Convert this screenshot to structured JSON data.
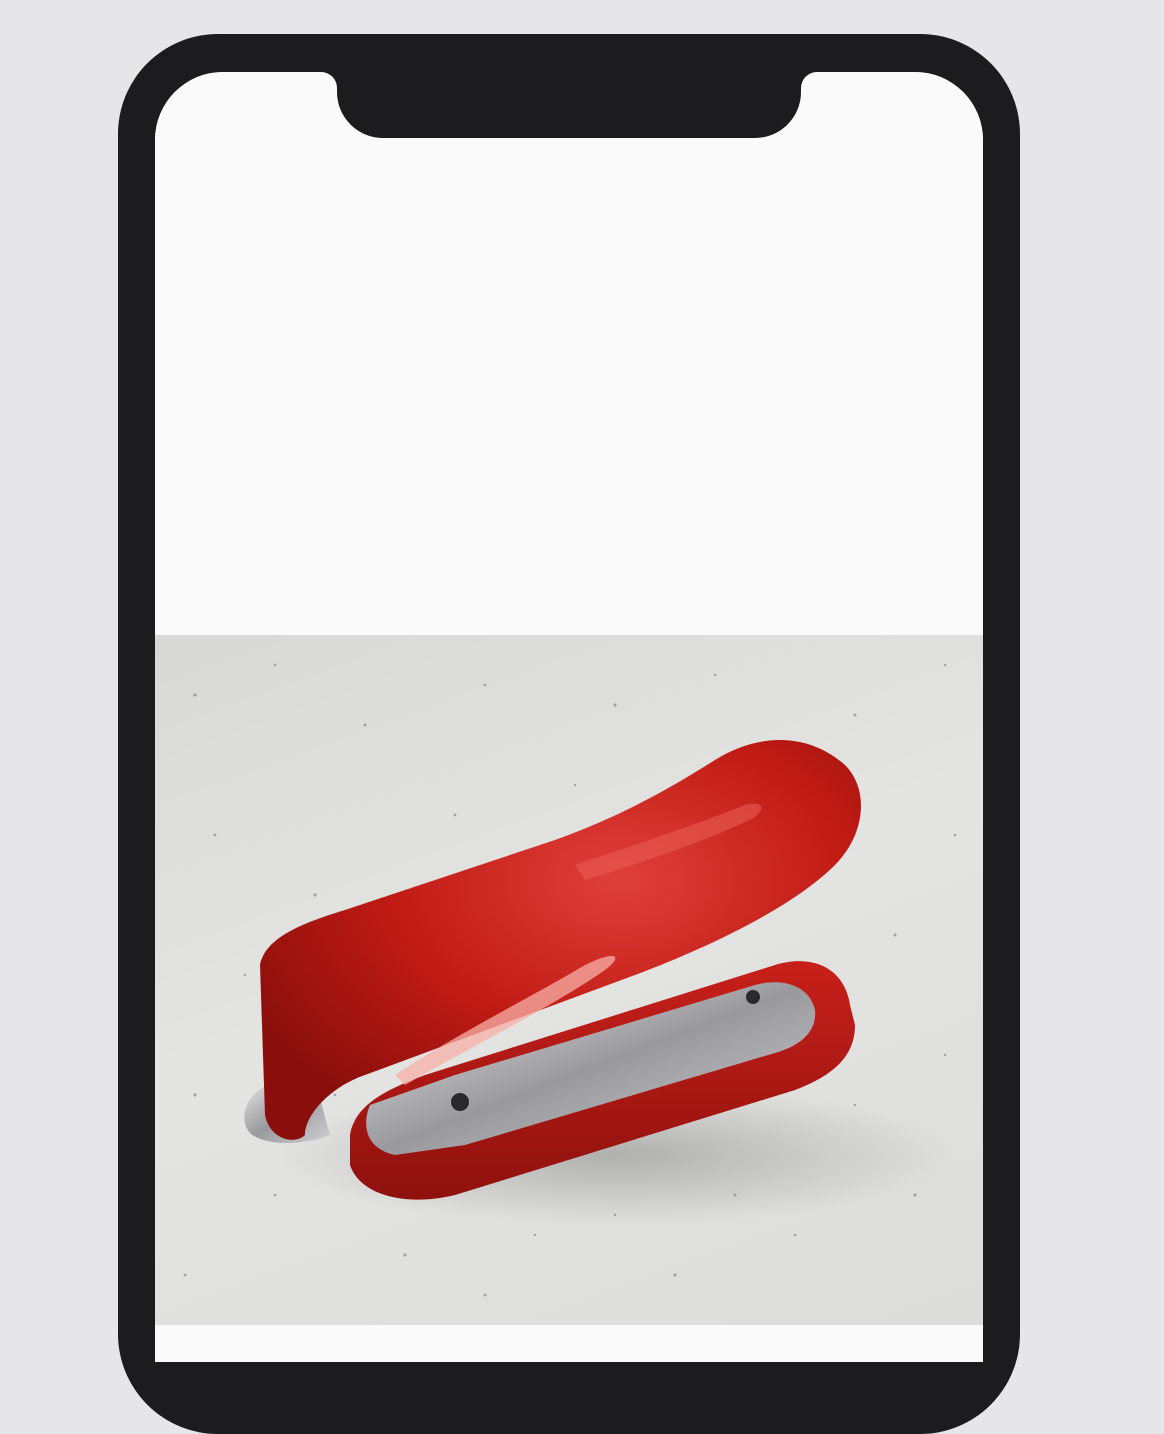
{
  "device": {
    "frame_color": "#1c1c1e",
    "screen_color": "#fafafa"
  },
  "photo": {
    "subject": "red-mini-stapler",
    "colors": {
      "body": "#c01a14",
      "highlight": "#e8504a",
      "surface": "#dededc",
      "metal": "#b8b8bc"
    }
  }
}
